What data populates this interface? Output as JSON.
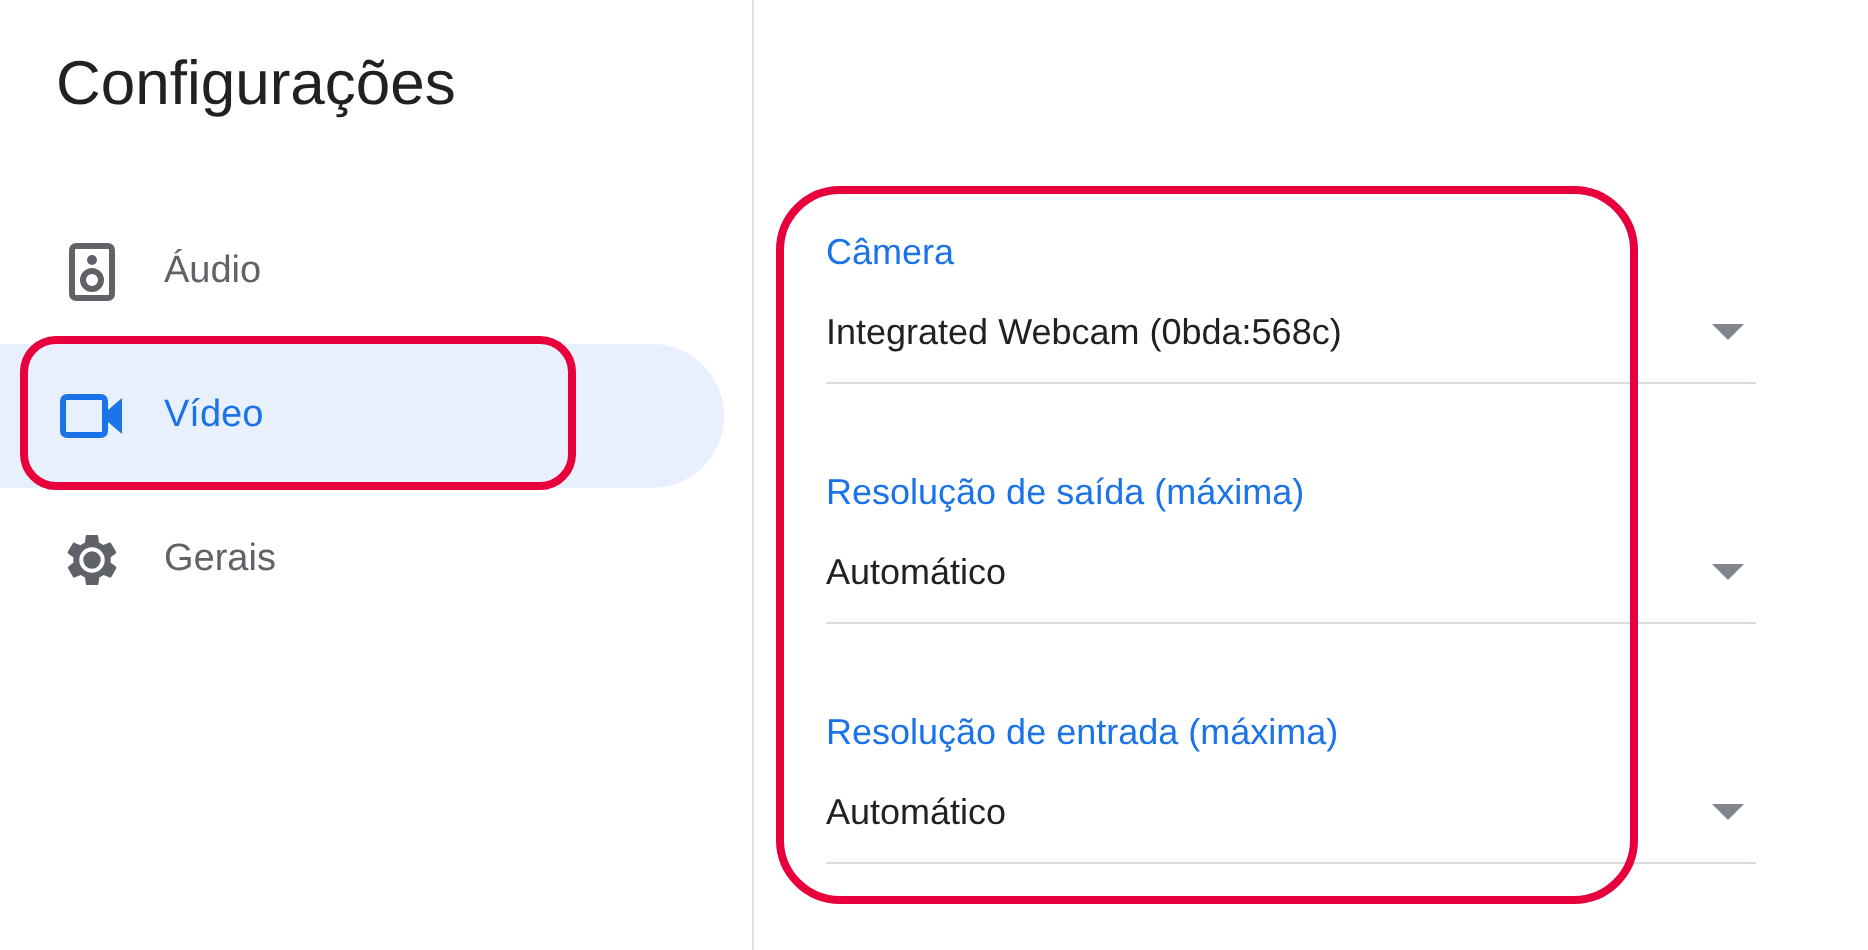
{
  "sidebar": {
    "title": "Configurações",
    "items": [
      {
        "kind": "speaker",
        "label": "Áudio",
        "selected": false,
        "highlighted": false
      },
      {
        "kind": "camera",
        "label": "Vídeo",
        "selected": true,
        "highlighted": true
      },
      {
        "kind": "gear",
        "label": "Gerais",
        "selected": false,
        "highlighted": false
      }
    ]
  },
  "panel": {
    "highlighted": true,
    "fields": [
      {
        "label": "Câmera",
        "value": "Integrated Webcam (0bda:568c)"
      },
      {
        "label": "Resolução de saída (máxima)",
        "value": "Automático"
      },
      {
        "label": "Resolução de entrada (máxima)",
        "value": "Automático"
      }
    ]
  }
}
